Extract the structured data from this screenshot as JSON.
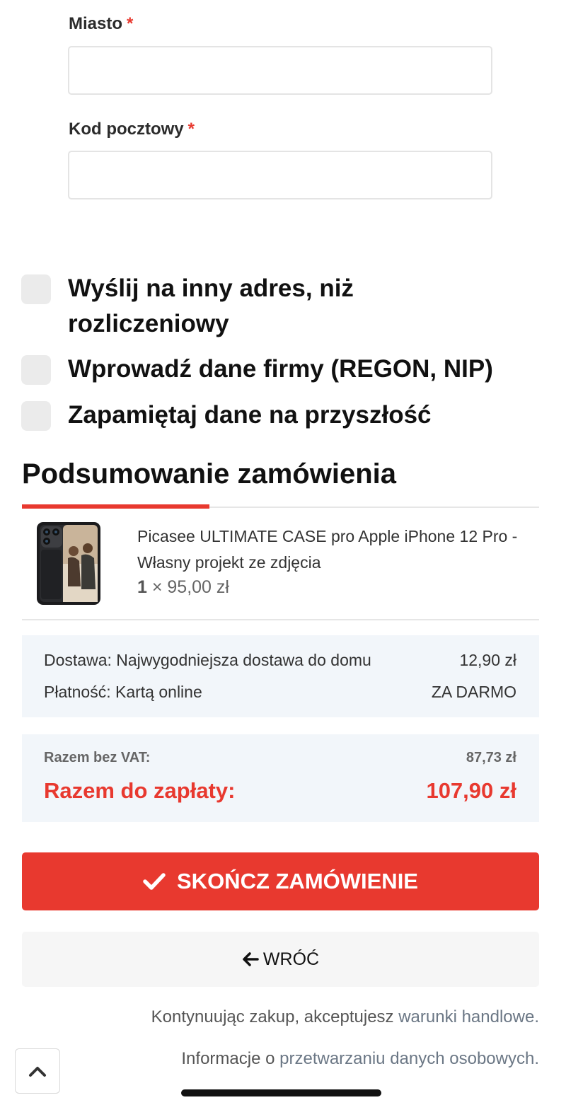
{
  "form": {
    "city": {
      "label": "Miasto",
      "required_mark": "*",
      "value": ""
    },
    "postal_code": {
      "label": "Kod pocztowy",
      "required_mark": "*",
      "value": ""
    }
  },
  "options": [
    {
      "label": "Wyślij na inny adres, niż rozliczeniowy",
      "checked": false
    },
    {
      "label": "Wprowadź dane firmy (REGON, NIP)",
      "checked": false
    },
    {
      "label": "Zapamiętaj dane na przyszłość",
      "checked": false
    }
  ],
  "summary": {
    "title": "Podsumowanie zamówienia",
    "accent_color": "#e8392f",
    "product": {
      "name": "Picasee ULTIMATE CASE pro Apple iPhone 12 Pro - Własny projekt ze zdjęcia",
      "qty": "1",
      "price": "× 95,00 zł"
    },
    "costs": [
      {
        "label": "Dostawa: Najwygodniejsza dostawa do domu",
        "value": "12,90 zł"
      },
      {
        "label": "Płatność: Kartą online",
        "value": "ZA DARMO"
      }
    ],
    "net_label": "Razem bez VAT:",
    "net_value": "87,73 zł",
    "total_label": "Razem do zapłaty:",
    "total_value": "107,90 zł"
  },
  "actions": {
    "finish_label": "SKOŃCZ ZAMÓWIENIE",
    "back_label": "WRÓĆ"
  },
  "notes": {
    "terms_prefix": "Kontynuując zakup, akceptujesz ",
    "terms_link": "warunki handlowe.",
    "privacy_prefix": "Informacje o ",
    "privacy_link": "przetwarzaniu danych osobowych."
  }
}
